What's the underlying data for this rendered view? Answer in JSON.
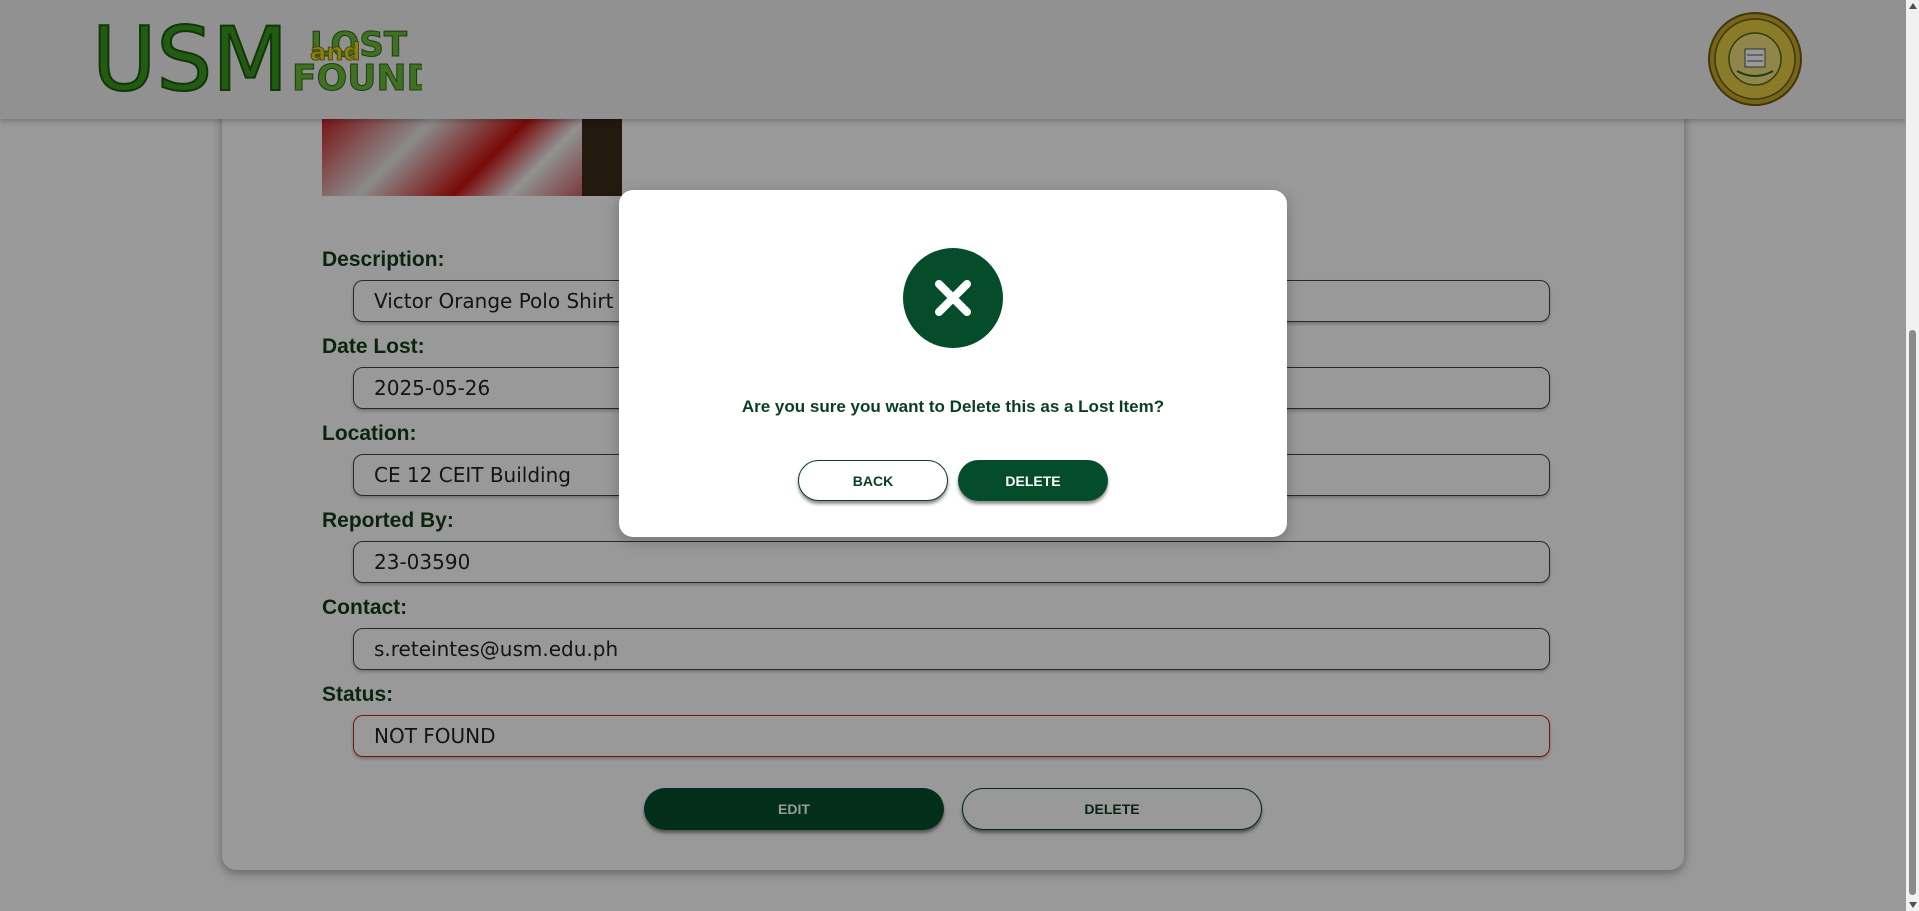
{
  "header": {
    "logo_text_main": "USM",
    "logo_text_lost": "LOST",
    "logo_text_and": "and",
    "logo_text_found": "FOUND",
    "seal_icon": "university-seal-icon"
  },
  "item": {
    "photo_icon": "item-photo",
    "fields": [
      {
        "label": "Description:",
        "value": "Victor Orange Polo Shirt"
      },
      {
        "label": "Date Lost:",
        "value": "2025-05-26"
      },
      {
        "label": "Location:",
        "value": "CE 12 CEIT Building"
      },
      {
        "label": "Reported By:",
        "value": "23-03590"
      },
      {
        "label": "Contact:",
        "value": "s.reteintes@usm.edu.ph"
      },
      {
        "label": "Status:",
        "value": "NOT FOUND"
      }
    ],
    "edit_label": "EDIT",
    "delete_label": "DELETE"
  },
  "modal": {
    "icon": "close-icon",
    "message": "Are you sure you want to Delete this as a Lost Item?",
    "back_label": "BACK",
    "delete_label": "DELETE"
  },
  "colors": {
    "primary": "#054d2a",
    "label": "#0f3f17",
    "status_border": "#d21f1f",
    "logo_green": "#3a9a1f",
    "logo_yellow": "#e8d21a"
  }
}
